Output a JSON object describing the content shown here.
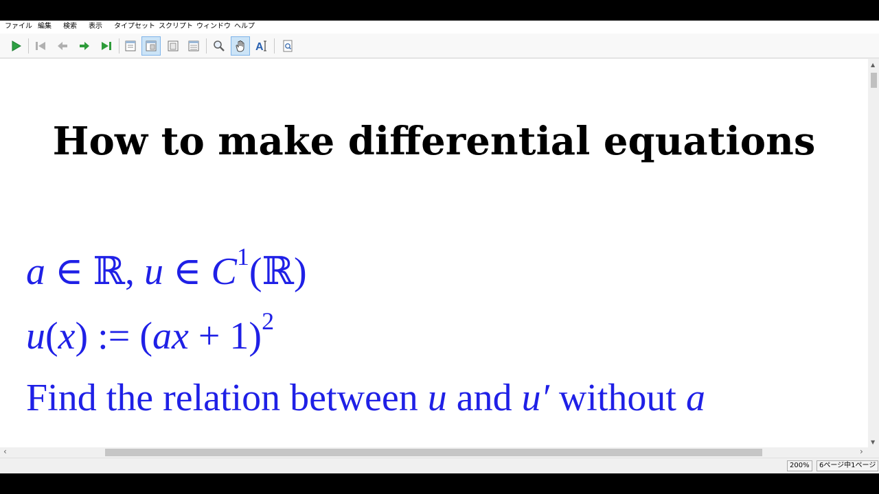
{
  "menubar": {
    "items": [
      "ファイル",
      "編集",
      "検索",
      "表示",
      "タイプセット",
      "スクリプト",
      "ウィンドウ",
      "ヘルプ"
    ]
  },
  "toolbar": {
    "icons": [
      "typeset-run-icon",
      "first-page-icon",
      "previous-page-icon",
      "next-page-icon",
      "last-page-icon",
      "single-page-icon",
      "continuous-page-icon",
      "facing-pages-icon",
      "fit-width-icon",
      "magnifier-icon",
      "hand-tool-icon",
      "text-select-icon",
      "find-icon"
    ],
    "active_tool": "continuous-page-icon",
    "colors": {
      "play": "#2ea043",
      "nav_arrow": "#2e9c3a",
      "active_bg": "#cce4f7"
    }
  },
  "document": {
    "title": "How to make differential equations",
    "line1": {
      "a": "a",
      "in1": " ∈ ",
      "R1": "ℝ",
      "comma": ", ",
      "u": "u",
      "in2": " ∈ ",
      "C": "C",
      "exp": "1",
      "paren_open": "(",
      "R2": "ℝ",
      "paren_close": ")"
    },
    "line2": {
      "u": "u",
      "open1": "(",
      "x": "x",
      "close1": ")",
      "assign": " := (",
      "ax": "ax",
      "plus": " + 1)",
      "exp": "2"
    },
    "line3": {
      "find": "Find the relation between ",
      "u1": "u",
      "and": " and ",
      "u2": "u′",
      "without": " without ",
      "a": "a"
    },
    "math_color": "#1f20e6"
  },
  "scrollbars": {
    "horizontal": {
      "left_arrow": "‹",
      "right_arrow": "›"
    },
    "vertical": {
      "up_arrow": "▲",
      "down_arrow": "▼"
    }
  },
  "status": {
    "zoom": "200%",
    "page": "6ページ中1ページ"
  }
}
